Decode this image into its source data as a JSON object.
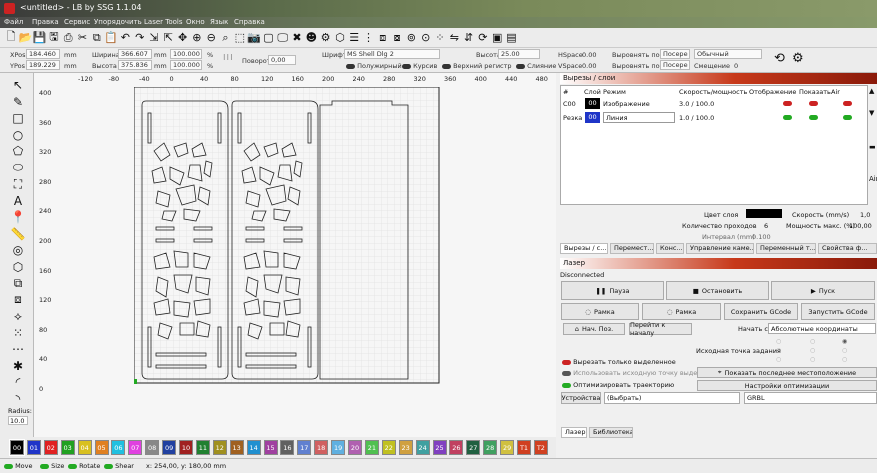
{
  "window": {
    "title": "<untitled> - LB by SSG 1.1.04"
  },
  "menu": [
    "Файл",
    "Правка",
    "Сервис",
    "Упорядочить",
    "Laser Tools",
    "Окно",
    "Язык",
    "Справка"
  ],
  "toolbar_icons": [
    "new-file-icon",
    "open-folder-icon",
    "save-icon",
    "save-as-icon",
    "print-icon",
    "cut-icon",
    "copy-icon",
    "paste-icon",
    "undo-icon",
    "redo-icon",
    "import-icon",
    "export-icon",
    "move-icon",
    "zoom-in-icon",
    "zoom-out-icon",
    "zoom-fit-icon",
    "zoom-page-icon",
    "camera-icon",
    "frame-icon",
    "monitor-icon",
    "tools-icon",
    "user-icon",
    "settings-icon",
    "weld-icon",
    "align-icon",
    "distribute-icon",
    "group-icon",
    "ungroup-icon",
    "target-icon",
    "center-icon",
    "dots-icon",
    "mirror-h-icon",
    "mirror-v-icon",
    "rotate-icon",
    "dock-icon",
    "layout-icon"
  ],
  "props": {
    "xpos_label": "XPos",
    "xpos": "184.460",
    "ypos_label": "YPos",
    "ypos": "189.229",
    "unit": "mm",
    "width_label": "Ширина",
    "width": "366.607",
    "height_label": "Высота",
    "height": "375.836",
    "scale_w": "100.000",
    "scale_h": "100.000",
    "pct": "%",
    "rotate_label": "Поворот",
    "rotate": "0,00",
    "font_label": "Шрифт",
    "font": "MS Shell Dlg 2",
    "text_height_label": "Высота",
    "text_height": "25.00",
    "bold": "Полужирный",
    "italic": "Курсив",
    "upper": "Верхний регистр",
    "merge": "Слияние",
    "hspace_label": "HSpace",
    "hspace": "0.00",
    "vspace_label": "VSpace",
    "vspace": "0.00",
    "align_x_label": "Выровнять по X",
    "align_x": "Посере",
    "align_y_label": "Выровнять по Y",
    "align_y": "Посере",
    "mode": "Обычный",
    "offset_label": "Смещение",
    "offset": "0"
  },
  "left_tools": [
    "cursor-icon",
    "pencil-icon",
    "rect-icon",
    "circle-icon",
    "polygon-icon",
    "text-shape-icon",
    "frame-select-icon",
    "text-icon",
    "pin-icon",
    "ruler-icon",
    "offset-icon",
    "weld-icon",
    "copy-array-icon",
    "boolean-icon",
    "node-icon",
    "grid-array-icon",
    "copy-along-icon",
    "rotate-array-icon",
    "round-corner-icon",
    "fillet-icon"
  ],
  "radius": {
    "label": "Radius:",
    "value": "10.0"
  },
  "ruler_x": [
    "-120",
    "-80",
    "-40",
    "0",
    "40",
    "80",
    "120",
    "160",
    "200",
    "240",
    "280",
    "320",
    "360",
    "400",
    "440",
    "480"
  ],
  "ruler_y": [
    "400",
    "360",
    "320",
    "280",
    "240",
    "200",
    "160",
    "120",
    "80",
    "40",
    "0"
  ],
  "cuts": {
    "title": "Вырезы / слои",
    "headers": [
      "#",
      "Слой",
      "Режим",
      "Скорость/мощность",
      "Отображение",
      "Показать",
      "Air"
    ],
    "rows": [
      {
        "id": "C00",
        "layer": "00",
        "mode": "Изображение",
        "speed": "3.0 / 100.0"
      },
      {
        "id": "Резка",
        "layer": "00",
        "mode": "Линия",
        "speed": "1.0 / 100.0"
      }
    ],
    "layer_color_label": "Цвет слоя",
    "speed_label": "Скорость (mm/s)",
    "speed_val": "1,0",
    "passes_label": "Количество проходов",
    "passes_val": "6",
    "max_power_label": "Мощность макс. (%)",
    "max_power_val": "100,00",
    "interval_label": "Интервал (mm)",
    "interval_val": "0.100",
    "tabs": [
      "Вырезы / с...",
      "Перемест...",
      "Конс...",
      "Управление каме...",
      "Переменный т...",
      "Свойства ф..."
    ]
  },
  "laser": {
    "title": "Лазер",
    "status": "Disconnected",
    "pause": "Пауза",
    "stop": "Остановить",
    "start": "Пуск",
    "frame1": "Рамка",
    "frame2": "Рамка",
    "save_gcode": "Сохранить GCode",
    "run_gcode": "Запустить GCode",
    "home": "Нач. Поз.",
    "go_origin": "Перейти к началу",
    "start_from_label": "Начать с:",
    "start_from": "Абсолютные координаты",
    "origin_label": "Исходная точка задания",
    "cut_selected": "Вырезать только выделенное",
    "use_origin": "Использовать исходную точку выделения",
    "show_last": "Показать последнее местоположение",
    "optimize": "Оптимизировать траекторию",
    "opt_settings": "Настройки оптимизации",
    "devices": "Устройства",
    "port": "(Выбрать)",
    "controller": "GRBL",
    "tabs": [
      "Лазер",
      "Библиотека"
    ]
  },
  "palette": [
    {
      "n": "00",
      "c": "#000000"
    },
    {
      "n": "01",
      "c": "#1f35c8"
    },
    {
      "n": "02",
      "c": "#e02020"
    },
    {
      "n": "03",
      "c": "#20a020"
    },
    {
      "n": "04",
      "c": "#d8c020"
    },
    {
      "n": "05",
      "c": "#e08020"
    },
    {
      "n": "06",
      "c": "#20c0e0"
    },
    {
      "n": "07",
      "c": "#e040e0"
    },
    {
      "n": "08",
      "c": "#888888"
    },
    {
      "n": "09",
      "c": "#2040a0"
    },
    {
      "n": "10",
      "c": "#a02020"
    },
    {
      "n": "11",
      "c": "#208030"
    },
    {
      "n": "12",
      "c": "#a09020"
    },
    {
      "n": "13",
      "c": "#a06020"
    },
    {
      "n": "14",
      "c": "#2090d0"
    },
    {
      "n": "15",
      "c": "#a040a0"
    },
    {
      "n": "16",
      "c": "#606060"
    },
    {
      "n": "17",
      "c": "#6080d0"
    },
    {
      "n": "18",
      "c": "#d06060"
    },
    {
      "n": "19",
      "c": "#60b0e0"
    },
    {
      "n": "20",
      "c": "#b060b0"
    },
    {
      "n": "21",
      "c": "#50c050"
    },
    {
      "n": "22",
      "c": "#c0c020"
    },
    {
      "n": "23",
      "c": "#d0a040"
    },
    {
      "n": "24",
      "c": "#40a0a0"
    },
    {
      "n": "25",
      "c": "#8040c0"
    },
    {
      "n": "26",
      "c": "#c04060"
    },
    {
      "n": "27",
      "c": "#206040"
    },
    {
      "n": "28",
      "c": "#40a060"
    },
    {
      "n": "29",
      "c": "#d0c040"
    },
    {
      "n": "T1",
      "c": "#d04020"
    },
    {
      "n": "T2",
      "c": "#d04020"
    }
  ],
  "status": {
    "move": "Move",
    "size": "Size",
    "rotate": "Rotate",
    "shear": "Shear",
    "coords": "x: 254,00, y: 180,00 mm"
  }
}
